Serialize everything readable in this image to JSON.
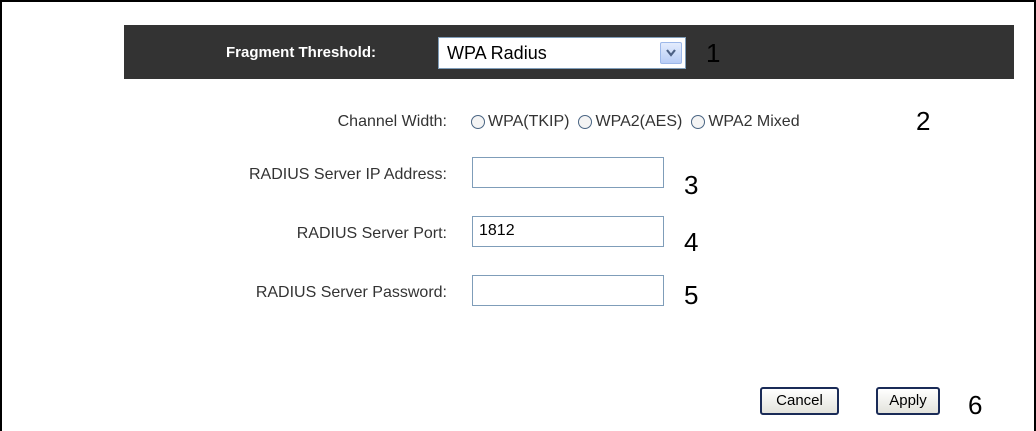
{
  "header": {
    "label": "Fragment Threshold:",
    "select_value": "WPA Radius",
    "callout": "1"
  },
  "channel_width": {
    "label": "Channel Width:",
    "options": [
      "WPA(TKIP)",
      "WPA2(AES)",
      "WPA2 Mixed"
    ],
    "callout": "2"
  },
  "radius_ip": {
    "label": "RADIUS Server IP Address:",
    "value": "",
    "callout": "3"
  },
  "radius_port": {
    "label": "RADIUS Server Port:",
    "value": "1812",
    "callout": "4"
  },
  "radius_password": {
    "label": "RADIUS Server Password:",
    "value": "",
    "callout": "5"
  },
  "actions": {
    "cancel_label": "Cancel",
    "apply_label": "Apply",
    "callout": "6"
  },
  "colors": {
    "header_bg": "#333333",
    "label_text": "#333333",
    "input_border": "#7f9db9",
    "button_border": "#1a2b57"
  },
  "icons": {
    "select_arrow": "chevron-down-icon",
    "radio": "radio-button-icon"
  }
}
